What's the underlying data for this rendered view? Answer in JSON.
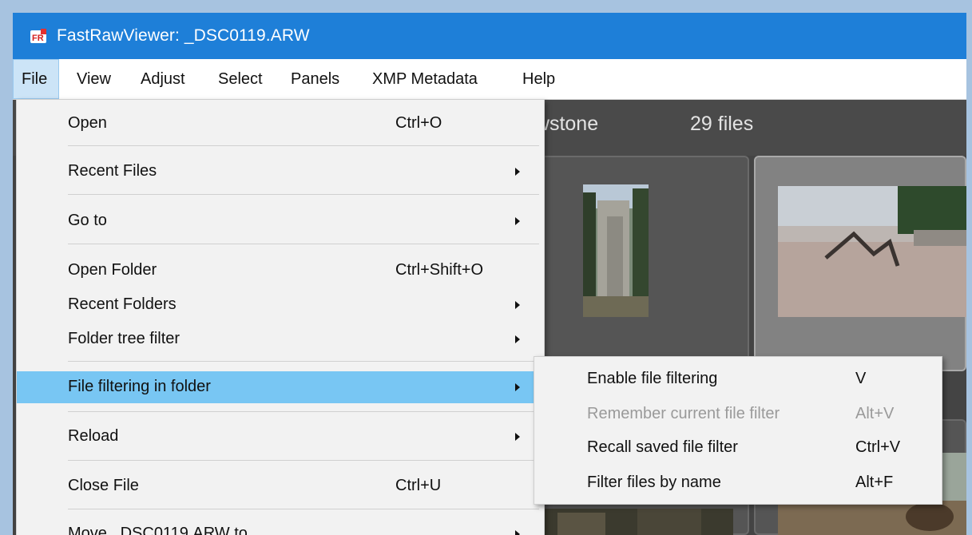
{
  "window": {
    "title": "FastRawViewer: _DSC0119.ARW"
  },
  "icons": {
    "app": "fastrawviewer-app-icon",
    "submenu": "chevron-right-icon"
  },
  "colors": {
    "titlebar": "#1e7fd8",
    "menu_highlight": "#78c6f3",
    "content_bg": "#3c3c3c"
  },
  "menubar": {
    "file": "File",
    "view": "View",
    "adjust": "Adjust",
    "select": "Select",
    "panels": "Panels",
    "xmp": "XMP Metadata",
    "help": "Help"
  },
  "content": {
    "folder_fragment": "owstone",
    "file_count": "29 files"
  },
  "file_menu": {
    "open": {
      "label": "Open",
      "shortcut": "Ctrl+O"
    },
    "recent_files": {
      "label": "Recent Files"
    },
    "go_to": {
      "label": "Go to"
    },
    "open_folder": {
      "label": "Open Folder",
      "shortcut": "Ctrl+Shift+O"
    },
    "recent_folders": {
      "label": "Recent Folders"
    },
    "folder_tree_filter": {
      "label": "Folder tree filter"
    },
    "file_filtering": {
      "label": "File filtering in folder"
    },
    "reload": {
      "label": "Reload"
    },
    "close_file": {
      "label": "Close File",
      "shortcut": "Ctrl+U"
    },
    "move_file": {
      "label": "Move _DSC0119.ARW to"
    }
  },
  "submenu": {
    "enable": {
      "label": "Enable file filtering",
      "shortcut": "V"
    },
    "remember": {
      "label": "Remember current file filter",
      "shortcut": "Alt+V"
    },
    "recall": {
      "label": "Recall saved file filter",
      "shortcut": "Ctrl+V"
    },
    "by_name": {
      "label": "Filter files by name",
      "shortcut": "Alt+F"
    }
  }
}
